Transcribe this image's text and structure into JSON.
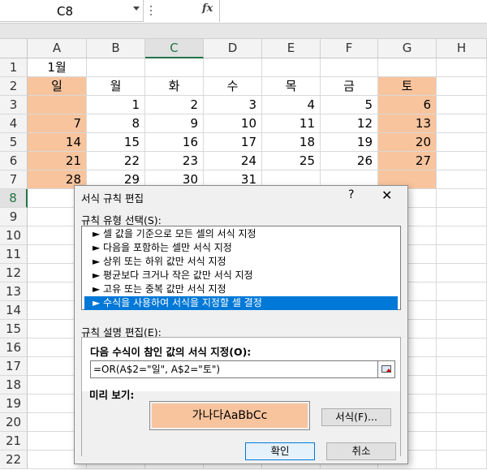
{
  "formula_bar": {
    "name_box": "C8",
    "fx_label": "fx"
  },
  "columns": [
    "A",
    "B",
    "C",
    "D",
    "E",
    "F",
    "G",
    "H"
  ],
  "rows": [
    "1",
    "2",
    "3",
    "4",
    "5",
    "6",
    "7",
    "8",
    "9",
    "10",
    "11",
    "12",
    "13",
    "14",
    "15",
    "16",
    "17",
    "18",
    "19",
    "20",
    "21",
    "22"
  ],
  "selected_cell": "C8",
  "calendar": {
    "month_title": "1월",
    "weekdays": [
      "일",
      "월",
      "화",
      "수",
      "목",
      "금",
      "토"
    ],
    "weeks": [
      [
        "",
        "1",
        "2",
        "3",
        "4",
        "5",
        "6"
      ],
      [
        "7",
        "8",
        "9",
        "10",
        "11",
        "12",
        "13"
      ],
      [
        "14",
        "15",
        "16",
        "17",
        "18",
        "19",
        "20"
      ],
      [
        "21",
        "22",
        "23",
        "24",
        "25",
        "26",
        "27"
      ],
      [
        "28",
        "29",
        "30",
        "31",
        "",
        "",
        ""
      ]
    ],
    "highlight_color": "#f8c49e"
  },
  "dialog": {
    "title": "서식 규칙 편집",
    "help": "?",
    "close": "✕",
    "rule_type_label": "규칙 유형 선택(S):",
    "rule_types": [
      "► 셀 값을 기준으로 모든 셀의 서식 지정",
      "► 다음을 포함하는 셀만 서식 지정",
      "► 상위 또는 하위 값만 서식 지정",
      "► 평균보다 크거나 작은 값만 서식 지정",
      "► 고유 또는 중복 값만 서식 지정",
      "► 수식을 사용하여 서식을 지정할 셀 결정"
    ],
    "selected_rule_index": 5,
    "rule_desc_label": "규칙 설명 편집(E):",
    "formula_heading": "다음 수식이 참인 값의 서식 지정(O):",
    "formula": "=OR(A$2=\"일\", A$2=\"토\")",
    "preview_label": "미리 보기:",
    "preview_text": "가나다AaBbCc",
    "format_button": "서식(F)...",
    "ok_button": "확인",
    "cancel_button": "취소",
    "accent_color": "#0078d7"
  }
}
